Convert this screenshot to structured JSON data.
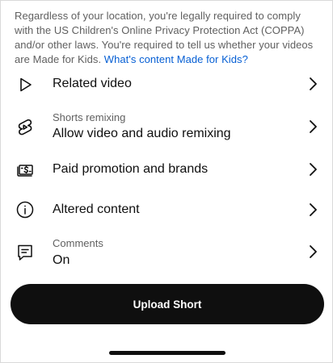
{
  "disclaimer": {
    "text": "Regardless of your location, you're legally required to comply with the US Children's Online Privacy Protection Act (COPPA) and/or other laws. You're required to tell us whether your videos are Made for Kids. ",
    "link": "What's content Made for Kids?"
  },
  "rows": [
    {
      "icon": "play-triangle-icon",
      "title": "Related video"
    },
    {
      "icon": "shorts-remix-icon",
      "subtitle": "Shorts remixing",
      "title": "Allow video and audio remixing"
    },
    {
      "icon": "paid-promotion-icon",
      "title": "Paid promotion and brands"
    },
    {
      "icon": "info-icon",
      "title": "Altered content"
    },
    {
      "icon": "comment-icon",
      "subtitle": "Comments",
      "title": "On"
    }
  ],
  "upload_button": {
    "label": "Upload Short"
  },
  "colors": {
    "text_primary": "#0f0f0f",
    "text_secondary": "#606060",
    "link": "#065fd4",
    "button_bg": "#0f0f0f",
    "button_text": "#ffffff"
  }
}
